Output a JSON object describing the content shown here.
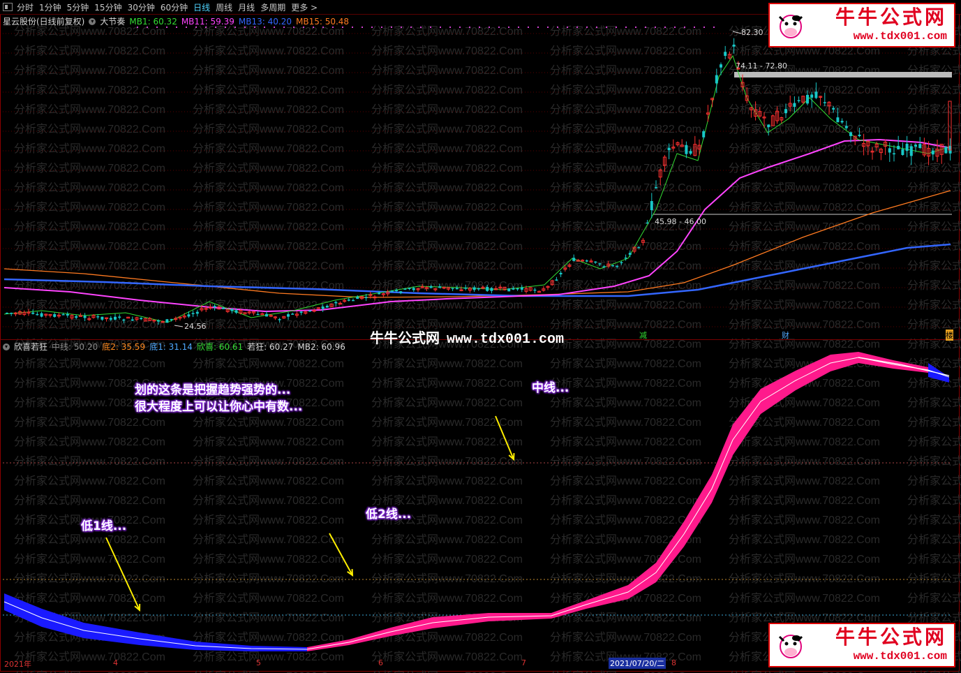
{
  "toolbar": {
    "items": [
      "分时",
      "1分钟",
      "5分钟",
      "15分钟",
      "30分钟",
      "60分钟",
      "日线",
      "周线",
      "月线",
      "多周期",
      "更多 >"
    ],
    "active_index": 6
  },
  "main_pane": {
    "stock_name": "星云股份(日线前复权)",
    "indicator_name": "大节奏",
    "mb1": "MB1: 60.32",
    "mb11": "MB11: 59.39",
    "mb13": "MB13: 40.20",
    "mb15": "MB15: 50.48",
    "price_high": "82.30",
    "range_high": "74.11 - 72.80",
    "range_low": "45.98 - 46.00",
    "price_low": "24.56",
    "marker_jian": "减",
    "marker_cai": "财",
    "marker_lou": "楼"
  },
  "sub_pane": {
    "indicator_name": "欣喜若狂",
    "mid": "中线: 50.20",
    "di2": "底2: 35.59",
    "di1": "底1: 31.14",
    "xinxi": "欣喜: 60.61",
    "ruokuang": "若狂: 60.27",
    "mb2": "MB2: 60.96"
  },
  "annotations": {
    "line1": "划的这条是把握趋势强势的...",
    "line2": "很大程度上可以让你心中有数...",
    "mid_label": "中线...",
    "low2_label": "低2线...",
    "low1_label": "低1线..."
  },
  "watermark": {
    "cn": "牛牛公式网",
    "url": "www.tdx001.com",
    "bg_text": "分析家公式网www.70822.Com"
  },
  "logo": {
    "cn": "牛牛公式网",
    "url": "www.tdx001.com"
  },
  "x_axis": {
    "year": "2021年",
    "m4": "4",
    "m5": "5",
    "m6": "6",
    "m7": "7",
    "cursor_date": "2021/07/20/二",
    "m8": "8"
  },
  "colors": {
    "mb1": "#33dd33",
    "mb11": "#ff44ff",
    "mb13": "#3366ff",
    "mb15": "#ff7a20",
    "up": "#ff3030",
    "down": "#18c8c8",
    "band_pink": "#ff1a8c",
    "band_blue": "#1a1aff"
  }
}
